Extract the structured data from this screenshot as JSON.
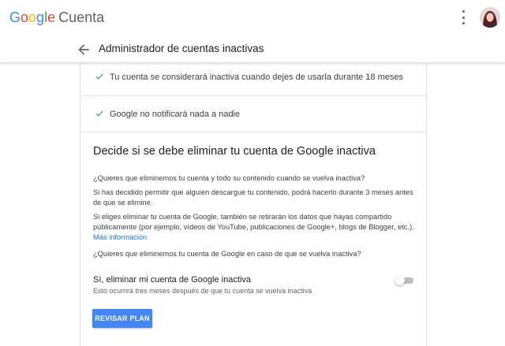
{
  "app": {
    "logo_google": "Google",
    "logo_product": "Cuenta",
    "more_options_icon": "more-vert-icon",
    "avatar_icon": "account-avatar"
  },
  "header": {
    "back_icon": "arrow-back-icon",
    "title": "Administrador de cuentas inactivas"
  },
  "summary": {
    "items": [
      {
        "icon": "check-icon",
        "text": "Tu cuenta se considerará inactiva cuando dejes de usarla durante 18 meses"
      },
      {
        "icon": "check-icon",
        "text": "Google no notificará nada a nadie"
      }
    ]
  },
  "delete_section": {
    "title": "Decide si se debe eliminar tu cuenta de Google inactiva",
    "question": "¿Quieres que eliminemos tu cuenta y todo su contenido cuando se vuelva inactiva?",
    "download_info": "Si has decidido permitir que alguien descargue tu contenido, podrá hacerlo durante 3 meses antes de que se elimine.",
    "shared_data_info": "Si eliges eliminar tu cuenta de Google, también se retirarán los datos que hayas compartido públicamente (por ejemplo, vídeos de YouTube, publicaciones de Google+, blogs de Blogger, etc.).",
    "more_info_link": "Más información",
    "confirm_question": "¿Quieres que eliminemos tu cuenta de Google en caso de que se vuelva inactiva?",
    "toggle_label": "Sí, eliminar mi cuenta de Google inactiva",
    "toggle_sub": "Esto ocurrirá tres meses después de que tu cuenta se vuelva inactiva",
    "toggle_on": false,
    "review_button": "REVISAR PLAN"
  },
  "colors": {
    "google_blue": "#4285f4",
    "google_red": "#ea4335",
    "google_yellow": "#fbbc05",
    "google_green": "#34a853",
    "check_green": "#1e8e3e",
    "link": "#1a73e8"
  }
}
